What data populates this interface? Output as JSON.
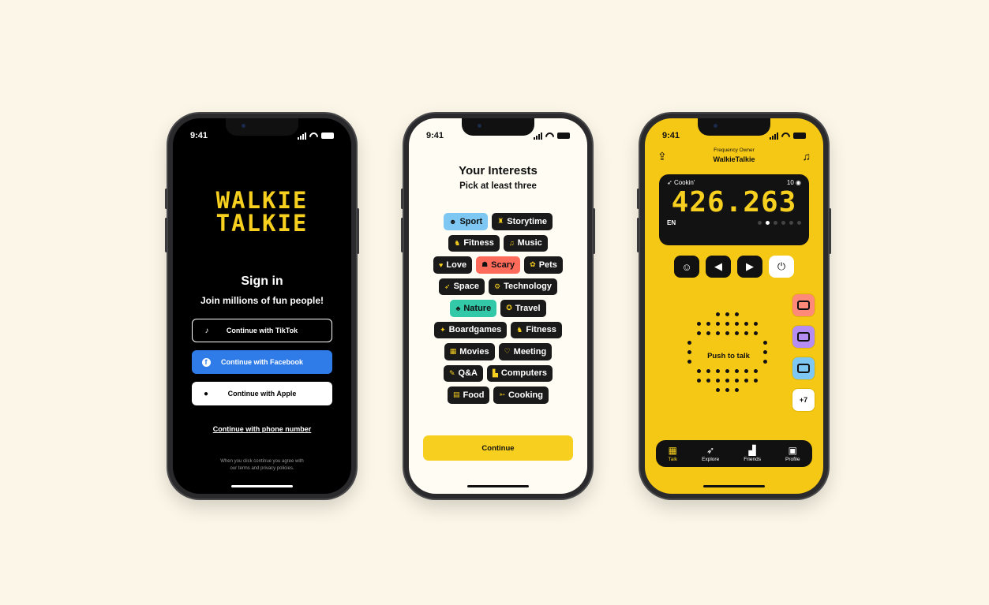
{
  "status": {
    "time": "9:41"
  },
  "signin": {
    "logo_line1": "WALKIE",
    "logo_line2": "TALKIE",
    "title": "Sign in",
    "subtitle": "Join millions of fun people!",
    "tiktok_label": "Continue with TikTok",
    "facebook_label": "Continue with Facebook",
    "apple_label": "Continue with Apple",
    "phone_label": "Continue with phone number",
    "terms_line1": "When you click continue you agree with",
    "terms_line2": "our terms and privacy policies."
  },
  "interests": {
    "title": "Your Interests",
    "subtitle": "Pick at least three",
    "rows": [
      [
        {
          "label": "Sport",
          "icon": "☻",
          "style": "blue"
        },
        {
          "label": "Storytime",
          "icon": "♜",
          "style": ""
        }
      ],
      [
        {
          "label": "Fitness",
          "icon": "♞",
          "style": ""
        },
        {
          "label": "Music",
          "icon": "♫",
          "style": ""
        }
      ],
      [
        {
          "label": "Love",
          "icon": "♥",
          "style": ""
        },
        {
          "label": "Scary",
          "icon": "☗",
          "style": "red"
        },
        {
          "label": "Pets",
          "icon": "✿",
          "style": ""
        }
      ],
      [
        {
          "label": "Space",
          "icon": "➶",
          "style": ""
        },
        {
          "label": "Technology",
          "icon": "⚙",
          "style": ""
        }
      ],
      [
        {
          "label": "Nature",
          "icon": "♣",
          "style": "green"
        },
        {
          "label": "Travel",
          "icon": "✪",
          "style": ""
        }
      ],
      [
        {
          "label": "Boardgames",
          "icon": "✦",
          "style": ""
        },
        {
          "label": "Fitness",
          "icon": "♞",
          "style": ""
        }
      ],
      [
        {
          "label": "Movies",
          "icon": "▦",
          "style": ""
        },
        {
          "label": "Meeting",
          "icon": "♡",
          "style": ""
        }
      ],
      [
        {
          "label": "Q&A",
          "icon": "✎",
          "style": ""
        },
        {
          "label": "Computers",
          "icon": "▙",
          "style": ""
        }
      ],
      [
        {
          "label": "Food",
          "icon": "▤",
          "style": ""
        },
        {
          "label": "Cooking",
          "icon": "➳",
          "style": ""
        }
      ]
    ],
    "continue_label": "Continue"
  },
  "talk": {
    "owner_label": "Frequency Owner",
    "owner_name": "WalkieTalkie",
    "channel_name": "Cookin'",
    "listener_count": "10",
    "frequency": "426.263",
    "language": "EN",
    "ptt_label": "Push to talk",
    "more_count": "+7",
    "tabs": [
      "Talk",
      "Explore",
      "Friends",
      "Profile"
    ],
    "colors": {
      "yellow": "#f6c816",
      "accent": "#f6cf1f",
      "facebook": "#2f7ce8"
    }
  }
}
